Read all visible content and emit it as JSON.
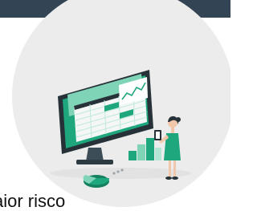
{
  "colors": {
    "top_bar": "#334555",
    "circle_bg": "#ececec",
    "accent_green": "#1ea67d",
    "monitor_dark": "#263238",
    "text": "#111111"
  },
  "illustration": {
    "icon": "data-analysis-illustration"
  },
  "caption": {
    "text": "aior risco"
  }
}
